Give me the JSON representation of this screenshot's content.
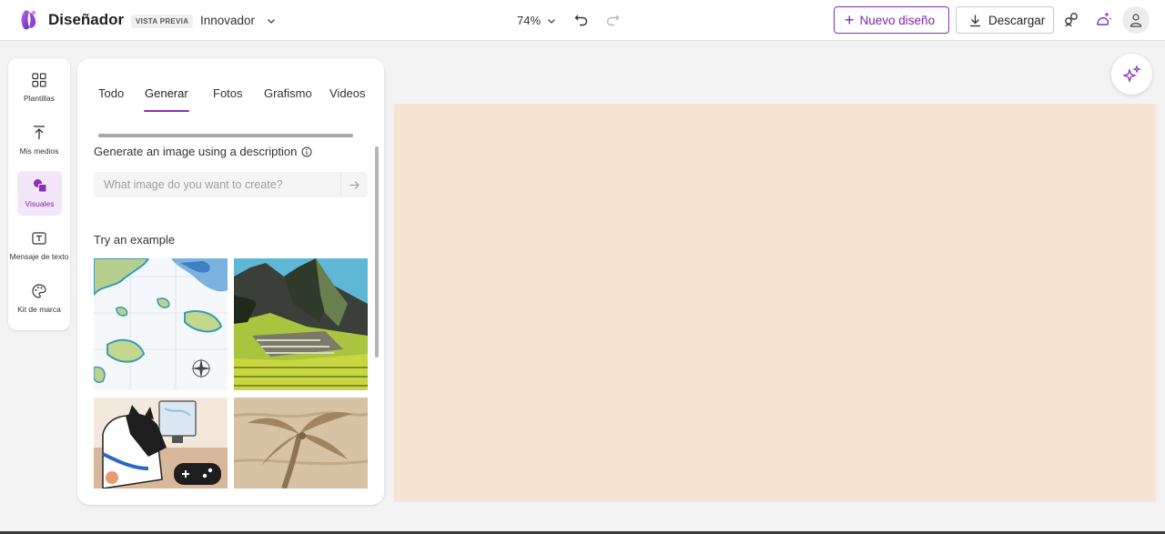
{
  "header": {
    "app_title": "Diseñador",
    "badge": "VISTA PREVIA",
    "plan": "Innovador",
    "zoom": "74%",
    "new_design_label": "Nuevo diseño",
    "download_label": "Descargar"
  },
  "rail": {
    "items": [
      {
        "label": "Plantillas",
        "icon": "templates-icon"
      },
      {
        "label": "Mis medios",
        "icon": "upload-icon"
      },
      {
        "label": "Visuales",
        "icon": "visuals-icon",
        "active": true
      },
      {
        "label": "Mensaje de texto",
        "icon": "text-icon"
      },
      {
        "label": "Kit de marca",
        "icon": "palette-icon"
      }
    ]
  },
  "panel": {
    "tabs": [
      "Todo",
      "Generar",
      "Fotos",
      "Grafismo",
      "Videos"
    ],
    "active_tab": "Generar",
    "generate_title": "Generate an image using a description",
    "prompt_placeholder": "What image do you want to create?",
    "try_label": "Try an example",
    "examples": [
      {
        "name": "map-illustration"
      },
      {
        "name": "mountain-ruins-illustration"
      },
      {
        "name": "cat-gamer-illustration"
      },
      {
        "name": "sand-palm-sculpture"
      }
    ]
  },
  "colors": {
    "accent": "#8a2fb8",
    "canvas": "#f5e4d2",
    "background": "#f3f3f3"
  }
}
